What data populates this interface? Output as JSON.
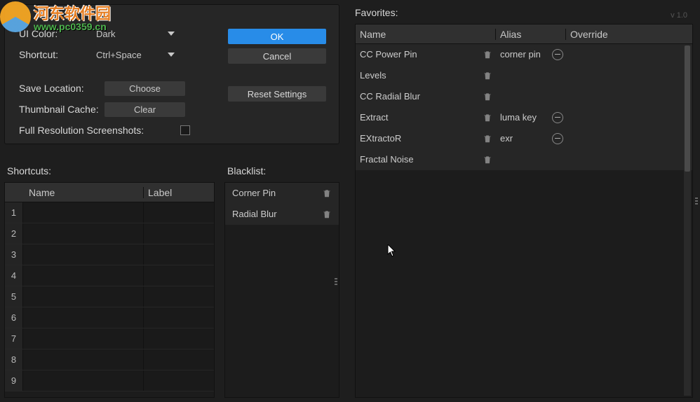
{
  "watermark": {
    "line1": "河东软件园",
    "line2": "www.pc0359.cn"
  },
  "version": "v 1.0",
  "settings": {
    "uiColorLabel": "UI Color:",
    "uiColorValue": "Dark",
    "shortcutLabel": "Shortcut:",
    "shortcutValue": "Ctrl+Space",
    "saveLocationLabel": "Save Location:",
    "chooseBtn": "Choose",
    "thumbCacheLabel": "Thumbnail Cache:",
    "clearBtn": "Clear",
    "fullResLabel": "Full Resolution Screenshots:",
    "okBtn": "OK",
    "cancelBtn": "Cancel",
    "resetBtn": "Reset Settings"
  },
  "shortcuts": {
    "title": "Shortcuts:",
    "headerName": "Name",
    "headerLabel": "Label",
    "rows": [
      {
        "num": "1",
        "name": "",
        "label": ""
      },
      {
        "num": "2",
        "name": "",
        "label": ""
      },
      {
        "num": "3",
        "name": "",
        "label": ""
      },
      {
        "num": "4",
        "name": "",
        "label": ""
      },
      {
        "num": "5",
        "name": "",
        "label": ""
      },
      {
        "num": "6",
        "name": "",
        "label": ""
      },
      {
        "num": "7",
        "name": "",
        "label": ""
      },
      {
        "num": "8",
        "name": "",
        "label": ""
      },
      {
        "num": "9",
        "name": "",
        "label": ""
      }
    ]
  },
  "blacklist": {
    "title": "Blacklist:",
    "rows": [
      {
        "name": "Corner Pin"
      },
      {
        "name": "Radial Blur"
      }
    ]
  },
  "favorites": {
    "title": "Favorites:",
    "headerName": "Name",
    "headerAlias": "Alias",
    "headerOverride": "Override",
    "rows": [
      {
        "name": "CC Power Pin",
        "alias": "corner pin",
        "hasAlias": true
      },
      {
        "name": "Levels",
        "alias": "",
        "hasAlias": false
      },
      {
        "name": "CC Radial Blur",
        "alias": "",
        "hasAlias": false
      },
      {
        "name": "Extract",
        "alias": "luma key",
        "hasAlias": true
      },
      {
        "name": "EXtractoR",
        "alias": "exr",
        "hasAlias": true
      },
      {
        "name": "Fractal Noise",
        "alias": "",
        "hasAlias": false
      }
    ]
  }
}
